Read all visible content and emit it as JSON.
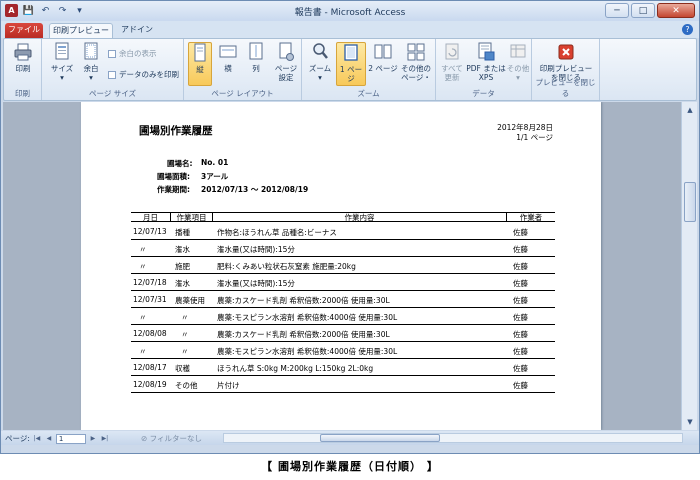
{
  "window": {
    "title": "報告書 - Microsoft Access",
    "minimize": "─",
    "maximize": "□",
    "close": "✕"
  },
  "quick_access": {
    "app_letter": "A",
    "save": "💾",
    "undo": "↶",
    "redo": "↷",
    "more": "▾"
  },
  "tabs": {
    "file": "ファイル",
    "print_preview": "印刷プレビュー",
    "addin": "アドイン",
    "help": "?"
  },
  "ribbon": {
    "print": {
      "label": "印刷",
      "button": "印刷"
    },
    "page_size": {
      "label": "ページ サイズ",
      "size": "サイズ",
      "margin": "余白",
      "show_margin": "余白の表示",
      "data_only": "データのみを印刷"
    },
    "page_layout": {
      "label": "ページ レイアウト",
      "portrait": "縦",
      "landscape": "横",
      "columns": "列",
      "page_setup_1": "ページ",
      "page_setup_2": "設定"
    },
    "zoom": {
      "label": "ズーム",
      "zoom": "ズーム",
      "one_page": "1 ページ",
      "two_pages": "2 ページ",
      "other_1": "その他の",
      "other_2": "ページ・"
    },
    "data": {
      "label": "データ",
      "refresh_1": "すべて",
      "refresh_2": "更新",
      "pdf_1": "PDF または",
      "pdf_2": "XPS",
      "other": "その他"
    },
    "close_preview": {
      "label": "プレビューを閉じる",
      "button_1": "印刷プレビュー",
      "button_2": "を閉じる"
    }
  },
  "statusbar": {
    "page_label": "ページ:",
    "page_value": "1",
    "filter": "フィルターなし"
  },
  "report": {
    "title": "圃場別作業履歴",
    "date": "2012年8月28日",
    "page": "1/1 ページ",
    "field_name_label": "圃場名:",
    "field_name_value": "No. 01",
    "field_area_label": "圃場面積:",
    "field_area_value": "3アール",
    "period_label": "作業期間:",
    "period_value": "2012/07/13 ～ 2012/08/19",
    "columns": {
      "month_day": "月日",
      "work_item": "作業項目",
      "content": "作業内容",
      "worker": "作業者"
    },
    "rows": [
      {
        "date": "12/07/13",
        "item": "播種",
        "content": "作物名:ほうれん草  品種名:ビーナス",
        "worker": "佐藤"
      },
      {
        "date": "〃",
        "item": "潅水",
        "content": "潅水量(又は時間):15分",
        "worker": "佐藤"
      },
      {
        "date": "〃",
        "item": "施肥",
        "content": "肥料:くみあい粒状石灰窒素  施肥量:20kg",
        "worker": "佐藤"
      },
      {
        "date": "12/07/18",
        "item": "潅水",
        "content": "潅水量(又は時間):15分",
        "worker": "佐藤"
      },
      {
        "date": "12/07/31",
        "item": "農薬使用",
        "content": "農薬:カスケード乳剤  希釈倍数:2000倍  使用量:30L",
        "worker": "佐藤"
      },
      {
        "date": "〃",
        "item": "〃",
        "content": "農薬:モスピラン水溶剤  希釈倍数:4000倍  使用量:30L",
        "worker": "佐藤"
      },
      {
        "date": "12/08/08",
        "item": "〃",
        "content": "農薬:カスケード乳剤  希釈倍数:2000倍  使用量:30L",
        "worker": "佐藤"
      },
      {
        "date": "〃",
        "item": "〃",
        "content": "農薬:モスピラン水溶剤  希釈倍数:4000倍  使用量:30L",
        "worker": "佐藤"
      },
      {
        "date": "12/08/17",
        "item": "収穫",
        "content": "ほうれん草  S:0kg  M:200kg  L:150kg  2L:0kg",
        "worker": "佐藤"
      },
      {
        "date": "12/08/19",
        "item": "その他",
        "content": "片付け",
        "worker": "佐藤"
      }
    ]
  },
  "caption": "【  圃場別作業履歴（日付順）  】"
}
